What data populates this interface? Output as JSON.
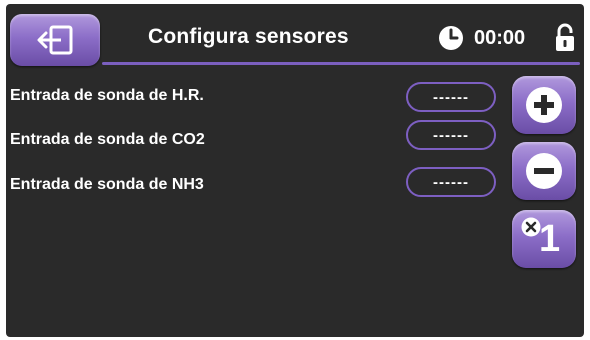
{
  "header": {
    "title": "Configura sensores",
    "time": "00:00",
    "back_icon": "exit-door-arrow-icon",
    "clock_icon": "clock-icon",
    "lock_icon": "unlocked-padlock-icon"
  },
  "rows": [
    {
      "label": "Entrada de sonda de H.R.",
      "value": "------"
    },
    {
      "label": "Entrada de sonda de CO2",
      "value": "------"
    },
    {
      "label": "Entrada de sonda de NH3",
      "value": "------"
    }
  ],
  "controls": {
    "plus_icon": "plus-icon",
    "minus_icon": "minus-icon",
    "multiplier_label": "1",
    "multiplier_icon": "multiply-icon"
  },
  "colors": {
    "background": "#2a2a2a",
    "accent": "#7b5fbf",
    "button_light": "#b199dd",
    "button_dark": "#6a4da6",
    "text": "#ffffff"
  }
}
